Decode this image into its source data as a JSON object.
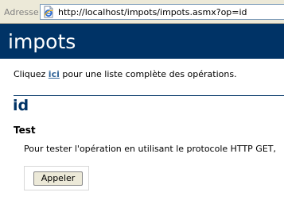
{
  "browser": {
    "address_label": "Adresse",
    "url": "http://localhost/impots/impots.asmx?op=id",
    "page_icon": "ie-page-icon"
  },
  "page": {
    "service_title": "impots",
    "intro_prefix": "Cliquez ",
    "intro_link": "ici",
    "intro_suffix": " pour une liste complète des opérations.",
    "operation_name": "id",
    "test_heading": "Test",
    "test_description": "Pour tester l'opération en utilisant le protocole HTTP GET,",
    "invoke_label": "Appeler"
  },
  "colors": {
    "heading_band": "#003366",
    "link": "#336699",
    "chrome": "#ece9d8"
  }
}
